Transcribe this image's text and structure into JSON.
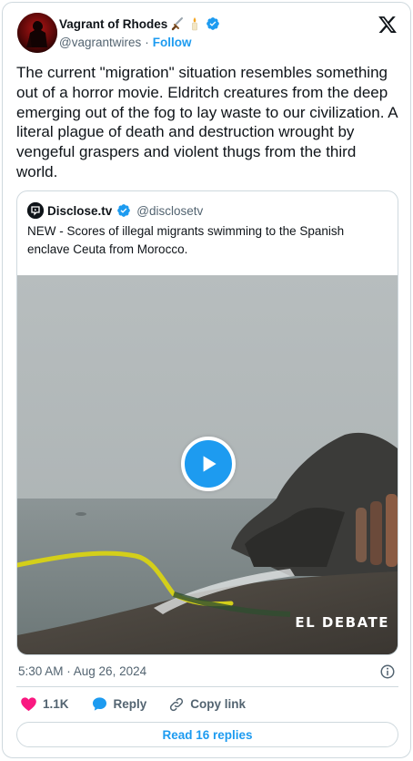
{
  "author": {
    "display_name": "Vagrant of Rhodes",
    "handle": "@vagrantwires",
    "separator": "·",
    "follow_label": "Follow"
  },
  "tweet": {
    "text": "The current \"migration\" situation resembles something out of a horror movie. Eldritch creatures from the deep emerging out of the fog to lay waste to our civilization. A literal plague of death and destruction wrought by vengeful graspers and violent thugs from the third world."
  },
  "quoted": {
    "display_name": "Disclose.tv",
    "handle": "@disclosetv",
    "text": "NEW - Scores of illegal migrants swimming to the Spanish enclave Ceuta from Morocco.",
    "media": {
      "type": "video",
      "watermark": "EL DEBATE"
    }
  },
  "meta": {
    "timestamp": "5:30 AM · Aug 26, 2024"
  },
  "actions": {
    "like_count": "1.1K",
    "reply_label": "Reply",
    "copy_link_label": "Copy link"
  },
  "read_replies_label": "Read 16 replies",
  "colors": {
    "accent": "#1d9bf0",
    "like": "#f91880",
    "text_primary": "#0f1419",
    "text_secondary": "#536471",
    "border": "#cfd9de"
  },
  "icons": {
    "x_logo": "x-logo-icon",
    "verified": "verified-badge-icon",
    "dagger_emoji": "dagger-emoji-icon",
    "candle_emoji": "candle-emoji-icon",
    "play": "play-icon",
    "info": "info-icon",
    "heart": "heart-icon",
    "reply": "reply-bubble-icon",
    "link": "link-icon"
  }
}
